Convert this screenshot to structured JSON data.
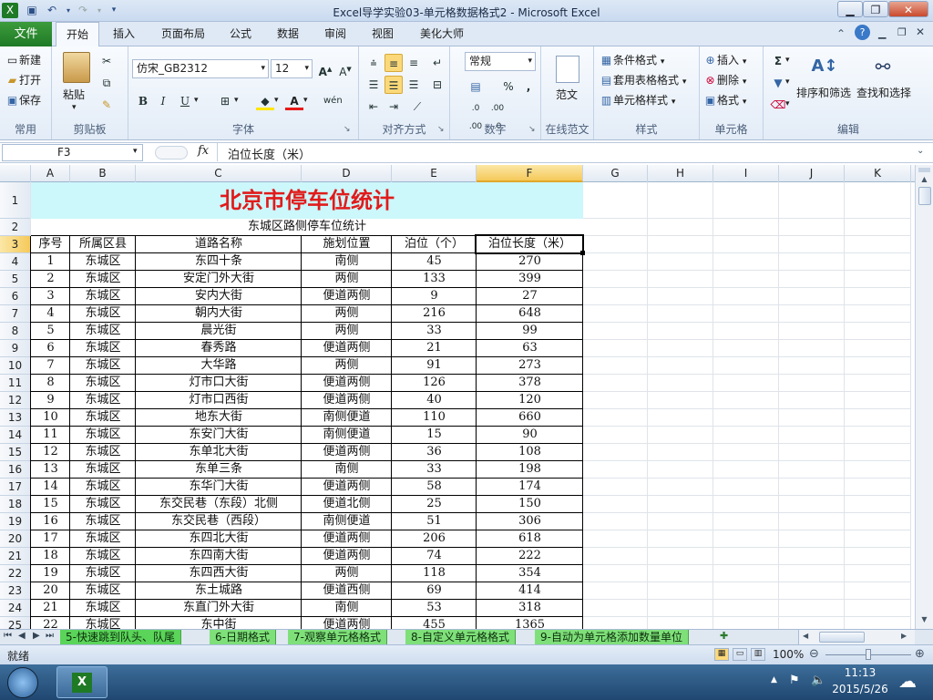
{
  "window": {
    "title": "Excel导学实验03-单元格数据格式2 - Microsoft Excel"
  },
  "qat": {
    "icons": [
      "excel-logo-icon",
      "save-icon",
      "undo-icon",
      "redo-icon"
    ]
  },
  "tabs": {
    "file": "文件",
    "items": [
      "开始",
      "插入",
      "页面布局",
      "公式",
      "数据",
      "审阅",
      "视图",
      "美化大师"
    ],
    "active": "开始"
  },
  "ribbon": {
    "clipboard": {
      "label": "常用",
      "new": "新建",
      "open": "打开",
      "save": "保存"
    },
    "paste": {
      "label": "剪贴板",
      "paste": "粘贴"
    },
    "font": {
      "label": "字体",
      "name": "仿宋_GB2312",
      "size": "12"
    },
    "alignment": {
      "label": "对齐方式"
    },
    "number": {
      "label": "数字",
      "format": "常规"
    },
    "online": {
      "label": "在线范文",
      "btn": "范文"
    },
    "styles": {
      "label": "样式",
      "cond": "条件格式",
      "table": "套用表格格式",
      "cell": "单元格样式"
    },
    "cells": {
      "label": "单元格",
      "insert": "插入",
      "delete": "删除",
      "format": "格式"
    },
    "editing": {
      "label": "编辑",
      "sort": "排序和筛选",
      "find": "查找和选择"
    }
  },
  "formula": {
    "namebox": "F3",
    "fx": "fx",
    "content": "泊位长度（米）"
  },
  "sheet": {
    "columns": [
      "A",
      "B",
      "C",
      "D",
      "E",
      "F",
      "G",
      "H",
      "I",
      "J",
      "K"
    ],
    "active_col": "F",
    "active_row": 3,
    "title": "北京市停车位统计",
    "subtitle": "东城区路侧停车位统计",
    "headers": [
      "序号",
      "所属区县",
      "道路名称",
      "施划位置",
      "泊位（个）",
      "泊位长度（米）"
    ],
    "rows": [
      [
        "1",
        "东城区",
        "东四十条",
        "南侧",
        "45",
        "270"
      ],
      [
        "2",
        "东城区",
        "安定门外大街",
        "两侧",
        "133",
        "399"
      ],
      [
        "3",
        "东城区",
        "安内大街",
        "便道两侧",
        "9",
        "27"
      ],
      [
        "4",
        "东城区",
        "朝内大街",
        "两侧",
        "216",
        "648"
      ],
      [
        "5",
        "东城区",
        "晨光街",
        "两侧",
        "33",
        "99"
      ],
      [
        "6",
        "东城区",
        "春秀路",
        "便道两侧",
        "21",
        "63"
      ],
      [
        "7",
        "东城区",
        "大华路",
        "两侧",
        "91",
        "273"
      ],
      [
        "8",
        "东城区",
        "灯市口大街",
        "便道两侧",
        "126",
        "378"
      ],
      [
        "9",
        "东城区",
        "灯市口西街",
        "便道两侧",
        "40",
        "120"
      ],
      [
        "10",
        "东城区",
        "地东大街",
        "南侧便道",
        "110",
        "660"
      ],
      [
        "11",
        "东城区",
        "东安门大街",
        "南侧便道",
        "15",
        "90"
      ],
      [
        "12",
        "东城区",
        "东单北大街",
        "便道两侧",
        "36",
        "108"
      ],
      [
        "13",
        "东城区",
        "东单三条",
        "南侧",
        "33",
        "198"
      ],
      [
        "14",
        "东城区",
        "东华门大街",
        "便道两侧",
        "58",
        "174"
      ],
      [
        "15",
        "东城区",
        "东交民巷（东段）北侧",
        "便道北侧",
        "25",
        "150"
      ],
      [
        "16",
        "东城区",
        "东交民巷（西段）",
        "南侧便道",
        "51",
        "306"
      ],
      [
        "17",
        "东城区",
        "东四北大街",
        "便道两侧",
        "206",
        "618"
      ],
      [
        "18",
        "东城区",
        "东四南大街",
        "便道两侧",
        "74",
        "222"
      ],
      [
        "19",
        "东城区",
        "东四西大街",
        "两侧",
        "118",
        "354"
      ],
      [
        "20",
        "东城区",
        "东土城路",
        "便道西侧",
        "69",
        "414"
      ],
      [
        "21",
        "东城区",
        "东直门外大街",
        "南侧",
        "53",
        "318"
      ],
      [
        "22",
        "东城区",
        "东中街",
        "便道两侧",
        "455",
        "1365"
      ]
    ]
  },
  "sheettabs": [
    "5-快速跳到队头、队尾",
    "6-日期格式",
    "7-观察单元格格式",
    "8-自定义单元格格式",
    "9-自动为单元格添加数量单位"
  ],
  "status": {
    "ready": "就绪",
    "zoom": "100%"
  },
  "taskbar": {
    "time": "11:13",
    "date": "2015/5/26"
  }
}
